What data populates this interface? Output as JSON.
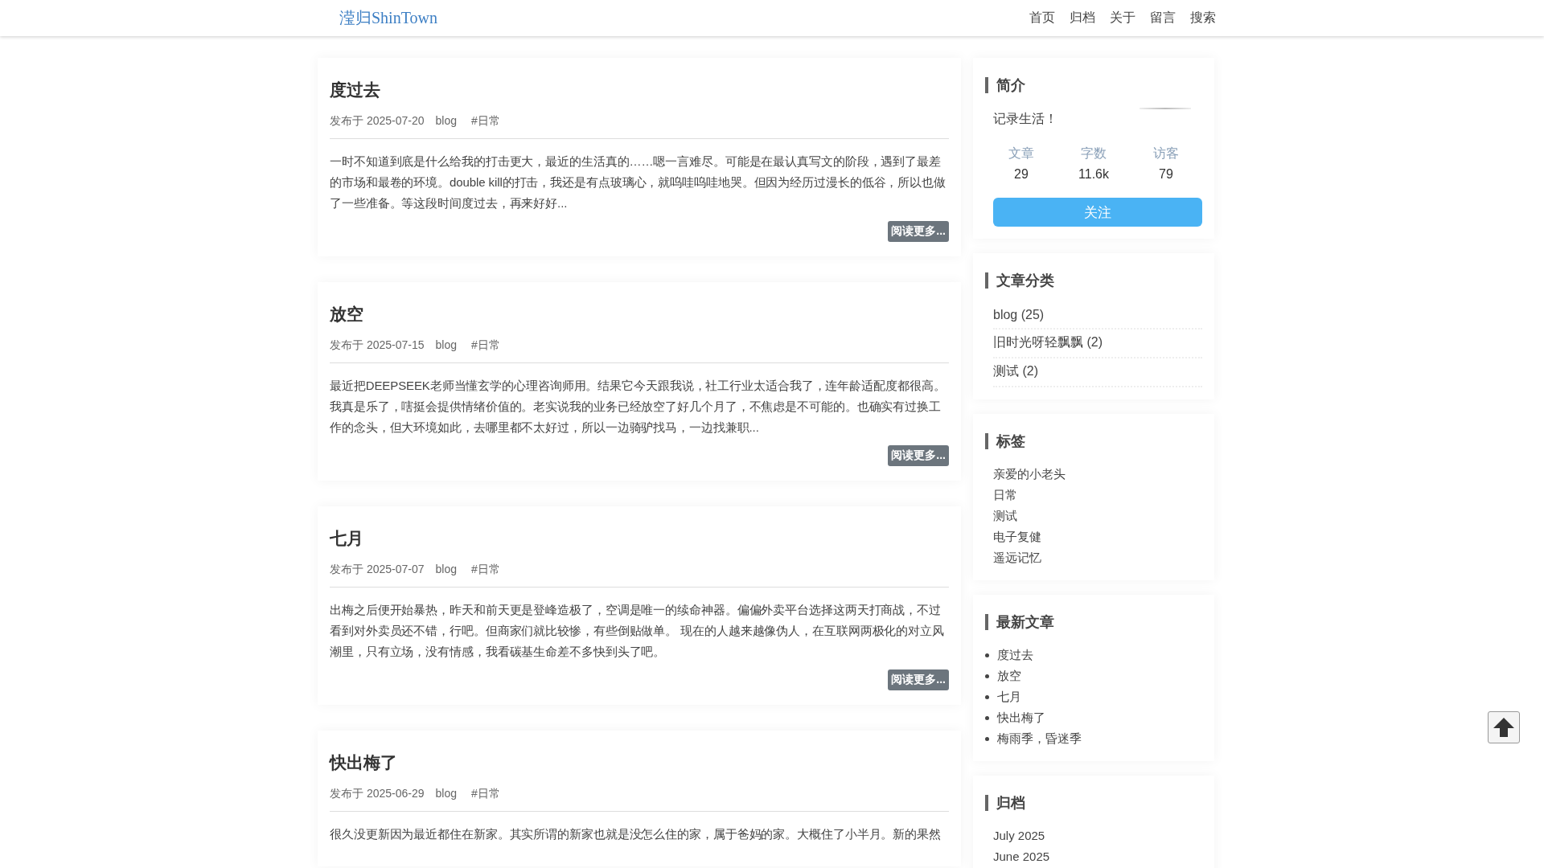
{
  "header": {
    "logo": "滢归ShinTown",
    "nav": [
      {
        "label": "首页"
      },
      {
        "label": "归档"
      },
      {
        "label": "关于"
      },
      {
        "label": "留言"
      },
      {
        "label": "搜索"
      }
    ]
  },
  "posts": [
    {
      "title": "度过去",
      "date_prefix": "发布于",
      "date": "2025-07-20",
      "category": "blog",
      "tag": "#日常",
      "excerpt": "一时不知道到底是什么给我的打击更大，最近的生活真的……嗯一言难尽。可能是在最认真写文的阶段，遇到了最差的市场和最卷的环境。double kill的打击，我还是有点玻璃心，就呜哇呜哇地哭。但因为经历过漫长的低谷，所以也做了一些准备。等这段时间度过去，再来好好...",
      "more": "阅读更多..."
    },
    {
      "title": "放空",
      "date_prefix": "发布于",
      "date": "2025-07-15",
      "category": "blog",
      "tag": "#日常",
      "excerpt": "最近把DEEPSEEK老师当懂玄学的心理咨询师用。结果它今天跟我说，社工行业太适合我了，连年龄适配度都很高。我真是乐了，嗐挺会提供情绪价值的。老实说我的业务已经放空了好几个月了，不焦虑是不可能的。也确实有过换工作的念头，但大环境如此，去哪里都不太好过，所以一边骑驴找马，一边找兼职...",
      "more": "阅读更多..."
    },
    {
      "title": "七月",
      "date_prefix": "发布于",
      "date": "2025-07-07",
      "category": "blog",
      "tag": "#日常",
      "excerpt": "出梅之后便开始暴热，昨天和前天更是登峰造极了，空调是唯一的续命神器。偏偏外卖平台选择这两天打商战，不过看到对外卖员还不错，行吧。但商家们就比较惨，有些倒贴做单。 现在的人越来越像伪人，在互联网两极化的对立风潮里，只有立场，没有情感，我看碳基生命差不多快到头了吧。",
      "more": "阅读更多..."
    },
    {
      "title": "快出梅了",
      "date_prefix": "发布于",
      "date": "2025-06-29",
      "category": "blog",
      "tag": "#日常",
      "excerpt": "很久没更新因为最近都住在新家。其实所谓的新家也就是没怎么住的家，属于爸妈的家。大概住了小半月。新的果然"
    }
  ],
  "sidebar": {
    "profile": {
      "title": "简介",
      "motto": "记录生活！",
      "stats": [
        {
          "label": "文章",
          "value": "29"
        },
        {
          "label": "字数",
          "value": "11.6k"
        },
        {
          "label": "访客",
          "value": "79"
        }
      ],
      "follow": "关注"
    },
    "categories": {
      "title": "文章分类",
      "items": [
        "blog (25)",
        "旧时光呀轻飘飘 (2)",
        "测试 (2)"
      ]
    },
    "tags": {
      "title": "标签",
      "items": [
        "亲爱的小老头",
        "日常",
        "测试",
        "电子复健",
        "遥远记忆"
      ]
    },
    "recent": {
      "title": "最新文章",
      "items": [
        "度过去",
        "放空",
        "七月",
        "快出梅了",
        "梅雨季，昏迷季"
      ]
    },
    "archive": {
      "title": "归档",
      "items": [
        "July 2025",
        "June 2025"
      ]
    }
  }
}
